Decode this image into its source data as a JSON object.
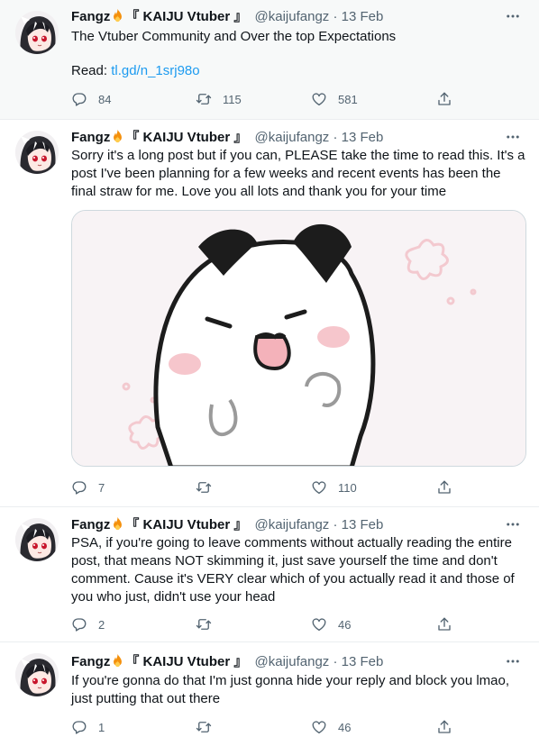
{
  "colors": {
    "link": "#1d9bf0",
    "secondary_text": "#536471",
    "divider": "#ebeef0",
    "highlight_bg": "#f7f9f9"
  },
  "tweets": [
    {
      "display_name": "Fangz",
      "display_name_suffix": "『 KAIJU Vtuber 』",
      "handle": "@kaijufangz",
      "separator": "·",
      "date": "13 Feb",
      "text": "The Vtuber Community and Over the top Expectations",
      "link_prefix": "Read: ",
      "link_text": "tl.gd/n_1srj98o",
      "replies": "84",
      "retweets": "115",
      "likes": "581"
    },
    {
      "display_name": "Fangz",
      "display_name_suffix": "『 KAIJU Vtuber 』",
      "handle": "@kaijufangz",
      "separator": "·",
      "date": "13 Feb",
      "text": "Sorry it's a long post but if you can, PLEASE take the time to read this. It's a post I've been planning for a few weeks and recent events has been the final straw for me. Love you all lots and thank you for your time",
      "replies": "7",
      "retweets": "",
      "likes": "110"
    },
    {
      "display_name": "Fangz",
      "display_name_suffix": "『 KAIJU Vtuber 』",
      "handle": "@kaijufangz",
      "separator": "·",
      "date": "13 Feb",
      "text": "PSA, if you're going to leave comments without actually reading the entire post, that means NOT skimming it, just save yourself the time and don't comment. Cause it's VERY clear which of you actually read it and those of you who just, didn't use your head",
      "replies": "2",
      "retweets": "",
      "likes": "46"
    },
    {
      "display_name": "Fangz",
      "display_name_suffix": "『 KAIJU Vtuber 』",
      "handle": "@kaijufangz",
      "separator": "·",
      "date": "13 Feb",
      "text": "If you're gonna do that I'm just gonna hide your reply and block you lmao, just putting that out there",
      "replies": "1",
      "retweets": "",
      "likes": "46"
    }
  ]
}
